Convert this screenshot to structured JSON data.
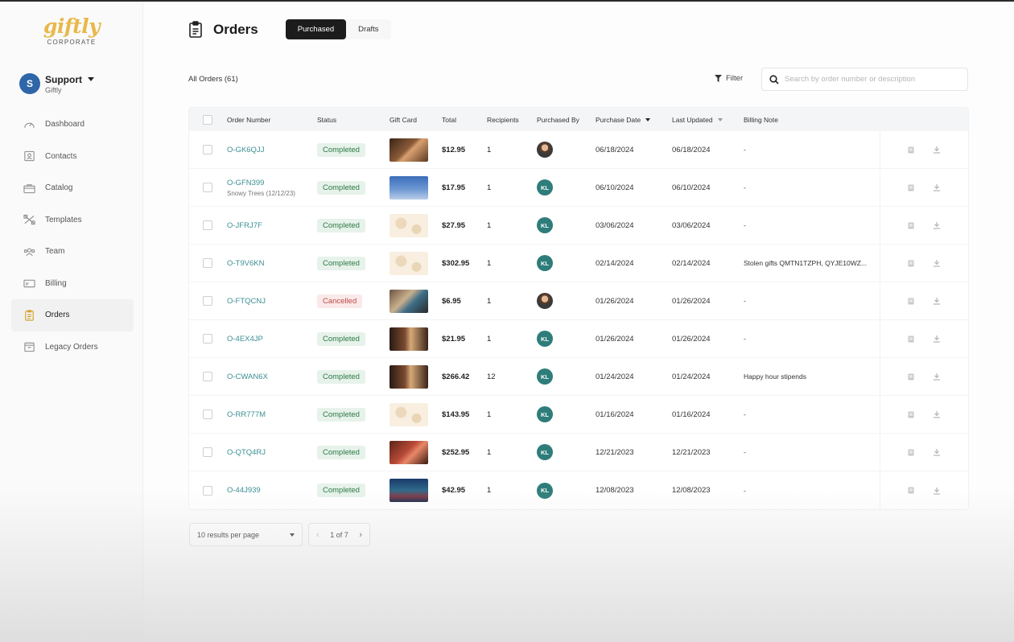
{
  "brand": {
    "logo": "giftly",
    "sub": "CORPORATE",
    "accent": "#e8b84a"
  },
  "account": {
    "initial": "S",
    "name": "Support",
    "org": "Giftly"
  },
  "nav": [
    {
      "label": "Dashboard",
      "icon": "dashboard-icon"
    },
    {
      "label": "Contacts",
      "icon": "contacts-icon"
    },
    {
      "label": "Catalog",
      "icon": "catalog-icon"
    },
    {
      "label": "Templates",
      "icon": "templates-icon"
    },
    {
      "label": "Team",
      "icon": "team-icon"
    },
    {
      "label": "Billing",
      "icon": "billing-icon"
    },
    {
      "label": "Orders",
      "icon": "orders-icon",
      "active": true
    },
    {
      "label": "Legacy Orders",
      "icon": "legacy-orders-icon"
    }
  ],
  "header": {
    "title": "Orders",
    "tabs": [
      "Purchased",
      "Drafts"
    ],
    "active_tab": "Purchased"
  },
  "toolbar": {
    "count": "All Orders (61)",
    "filter": "Filter",
    "search_placeholder": "Search by order number or description"
  },
  "columns": [
    "Order Number",
    "Status",
    "Gift Card",
    "Total",
    "Recipients",
    "Purchased By",
    "Purchase Date",
    "Last Updated",
    "Billing Note"
  ],
  "rows": [
    {
      "order": "O-GK6QJJ",
      "sub": "",
      "status": "Completed",
      "card": "card-1",
      "total": "$12.95",
      "recipients": "1",
      "by": "",
      "by_type": "photo",
      "purchase_date": "06/18/2024",
      "updated": "06/18/2024",
      "note": "-"
    },
    {
      "order": "O-GFN399",
      "sub": "Snowy Trees (12/12/23)",
      "status": "Completed",
      "card": "card-2",
      "total": "$17.95",
      "recipients": "1",
      "by": "KL",
      "by_type": "initials",
      "purchase_date": "06/10/2024",
      "updated": "06/10/2024",
      "note": "-"
    },
    {
      "order": "O-JFRJ7F",
      "sub": "",
      "status": "Completed",
      "card": "card-3",
      "total": "$27.95",
      "recipients": "1",
      "by": "KL",
      "by_type": "initials",
      "purchase_date": "03/06/2024",
      "updated": "03/06/2024",
      "note": "-"
    },
    {
      "order": "O-T9V6KN",
      "sub": "",
      "status": "Completed",
      "card": "card-3",
      "total": "$302.95",
      "recipients": "1",
      "by": "KL",
      "by_type": "initials",
      "purchase_date": "02/14/2024",
      "updated": "02/14/2024",
      "note": "Stolen gifts QMTN1TZPH, QYJE10WZ..."
    },
    {
      "order": "O-FTQCNJ",
      "sub": "",
      "status": "Cancelled",
      "card": "card-4",
      "total": "$6.95",
      "recipients": "1",
      "by": "",
      "by_type": "photo",
      "purchase_date": "01/26/2024",
      "updated": "01/26/2024",
      "note": "-"
    },
    {
      "order": "O-4EX4JP",
      "sub": "",
      "status": "Completed",
      "card": "card-5",
      "total": "$21.95",
      "recipients": "1",
      "by": "KL",
      "by_type": "initials",
      "purchase_date": "01/26/2024",
      "updated": "01/26/2024",
      "note": "-"
    },
    {
      "order": "O-CWAN6X",
      "sub": "",
      "status": "Completed",
      "card": "card-5",
      "total": "$266.42",
      "recipients": "12",
      "by": "KL",
      "by_type": "initials",
      "purchase_date": "01/24/2024",
      "updated": "01/24/2024",
      "note": "Happy hour stipends"
    },
    {
      "order": "O-RR777M",
      "sub": "",
      "status": "Completed",
      "card": "card-3",
      "total": "$143.95",
      "recipients": "1",
      "by": "KL",
      "by_type": "initials",
      "purchase_date": "01/16/2024",
      "updated": "01/16/2024",
      "note": "-"
    },
    {
      "order": "O-QTQ4RJ",
      "sub": "",
      "status": "Completed",
      "card": "card-6",
      "total": "$252.95",
      "recipients": "1",
      "by": "KL",
      "by_type": "initials",
      "purchase_date": "12/21/2023",
      "updated": "12/21/2023",
      "note": "-"
    },
    {
      "order": "O-44J939",
      "sub": "",
      "status": "Completed",
      "card": "card-7",
      "total": "$42.95",
      "recipients": "1",
      "by": "KL",
      "by_type": "initials",
      "purchase_date": "12/08/2023",
      "updated": "12/08/2023",
      "note": "-"
    }
  ],
  "pagination": {
    "per_page": "10 results per page",
    "page": "1 of 7"
  },
  "colors": {
    "link": "#3c8f94",
    "completed_bg": "#e6f2ea",
    "completed_fg": "#2d7a45",
    "cancelled_bg": "#fbe9e9",
    "cancelled_fg": "#c04848",
    "avatar_kl": "#2e7d7a",
    "tab_active": "#1c1c1c"
  }
}
